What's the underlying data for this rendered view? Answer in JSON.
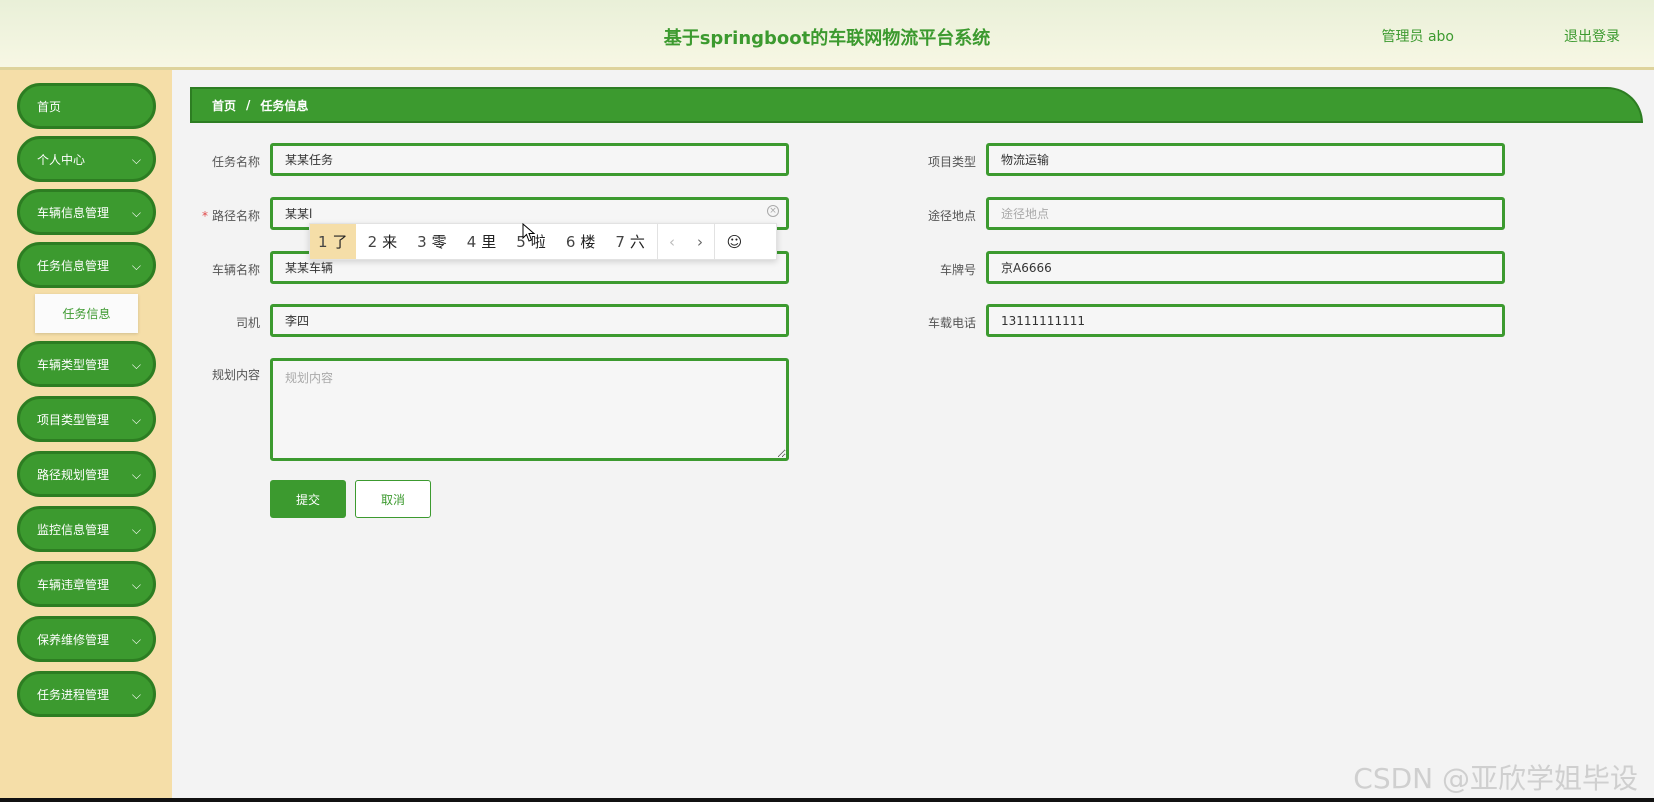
{
  "header": {
    "title": "基于springboot的车联网物流平台系统",
    "user": "管理员 abo",
    "logout": "退出登录"
  },
  "sidebar": {
    "items": [
      {
        "label": "首页"
      },
      {
        "label": "个人中心"
      },
      {
        "label": "车辆信息管理"
      },
      {
        "label": "任务信息管理"
      },
      {
        "label": "车辆类型管理"
      },
      {
        "label": "项目类型管理"
      },
      {
        "label": "路径规划管理"
      },
      {
        "label": "监控信息管理"
      },
      {
        "label": "车辆违章管理"
      },
      {
        "label": "保养维修管理"
      },
      {
        "label": "任务进程管理"
      }
    ],
    "sub_item": "任务信息"
  },
  "breadcrumb": {
    "home": "首页",
    "separator": "/",
    "current": "任务信息"
  },
  "form": {
    "task_name": {
      "label": "任务名称",
      "value": "某某任务"
    },
    "route_name": {
      "label": "路径名称",
      "value": "某某l",
      "required_mark": "*"
    },
    "vehicle_name": {
      "label": "车辆名称",
      "value": "某某车辆"
    },
    "driver": {
      "label": "司机",
      "value": "李四"
    },
    "plan_content": {
      "label": "规划内容",
      "placeholder": "规划内容"
    },
    "project_type": {
      "label": "项目类型",
      "value": "物流运输"
    },
    "waypoint": {
      "label": "途径地点",
      "placeholder": "途径地点"
    },
    "plate": {
      "label": "车牌号",
      "value": "京A6666"
    },
    "phone": {
      "label": "车载电话",
      "value": "13111111111"
    }
  },
  "buttons": {
    "submit": "提交",
    "cancel": "取消"
  },
  "ime": {
    "candidates": [
      {
        "num": "1",
        "char": "了"
      },
      {
        "num": "2",
        "char": "来"
      },
      {
        "num": "3",
        "char": "零"
      },
      {
        "num": "4",
        "char": "里"
      },
      {
        "num": "5",
        "char": "啦"
      },
      {
        "num": "6",
        "char": "楼"
      },
      {
        "num": "7",
        "char": "六"
      }
    ],
    "prev": "‹",
    "next": "›",
    "emoji": "☺"
  },
  "watermark": "CSDN @亚欣学姐毕设",
  "colors": {
    "primary": "#3c9a2f",
    "sidebar_bg": "#f5dea8",
    "header_bg": "#eef3dc"
  }
}
